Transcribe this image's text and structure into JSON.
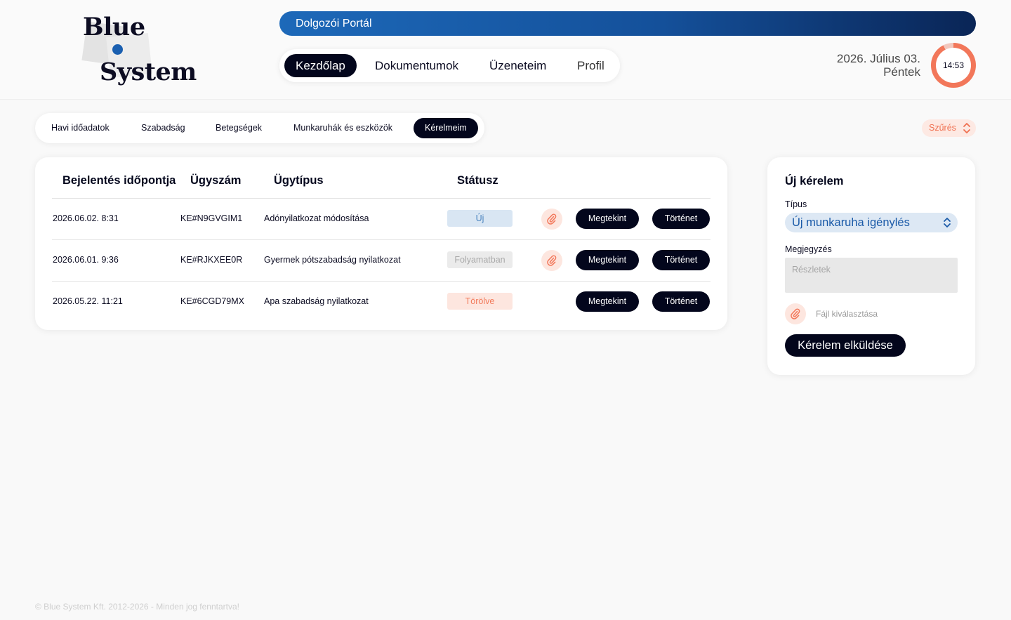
{
  "logo": {
    "line1": "Blue",
    "line2": "System"
  },
  "portal": {
    "title": "Dolgozói Portál"
  },
  "main_nav": {
    "items": [
      {
        "label": "Kezdőlap",
        "active": true
      },
      {
        "label": "Dokumentumok",
        "active": false
      },
      {
        "label": "Üzeneteim",
        "active": false
      },
      {
        "label": "Profil",
        "active": false
      }
    ]
  },
  "datetime": {
    "date": "2026. Július 03.",
    "weekday": "Péntek",
    "time": "14:53"
  },
  "sub_tabs": {
    "items": [
      {
        "label": "Havi időadatok",
        "active": false
      },
      {
        "label": "Szabadság",
        "active": false
      },
      {
        "label": "Betegségek",
        "active": false
      },
      {
        "label": "Munkaruhák és eszközök",
        "active": false
      },
      {
        "label": "Kérelmeim",
        "active": true
      }
    ]
  },
  "filter": {
    "label": "Szűrés"
  },
  "table": {
    "headers": [
      "Bejelentés időpontja",
      "Ügyszám",
      "Ügytípus",
      "Státusz"
    ],
    "rows": [
      {
        "date": "2026.06.02. 8:31",
        "case_no": "KE#N9GVGIM1",
        "type": "Adónyilatkozat módosítása",
        "status": "Új",
        "status_kind": "new",
        "has_attachment": true,
        "view": "Megtekint",
        "history": "Történet"
      },
      {
        "date": "2026.06.01. 9:36",
        "case_no": "KE#RJKXEE0R",
        "type": "Gyermek pótszabadság nyilatkozat",
        "status": "Folyamatban",
        "status_kind": "in-progress",
        "has_attachment": true,
        "view": "Megtekint",
        "history": "Történet"
      },
      {
        "date": "2026.05.22. 11:21",
        "case_no": "KE#6CGD79MX",
        "type": "Apa szabadság nyilatkozat",
        "status": "Törölve",
        "status_kind": "deleted",
        "has_attachment": false,
        "view": "Megtekint",
        "history": "Történet"
      }
    ]
  },
  "new_request": {
    "title": "Új kérelem",
    "type_label": "Típus",
    "type_value": "Új munkaruha igénylés",
    "note_label": "Megjegyzés",
    "note_placeholder": "Részletek",
    "file_label": "Fájl kiválasztása",
    "submit_label": "Kérelem elküldése"
  },
  "colors": {
    "accent_dark": "#03061c",
    "brand_blue": "#1a5fb0",
    "coral": "#f2775a",
    "status_new_bg": "#d9e6f3",
    "status_progress_bg": "#ebebeb",
    "status_deleted_bg": "#fde6df"
  },
  "icons": {
    "attachment": "paperclip-icon",
    "sort": "chevron-up-down-icon"
  },
  "footer": {
    "text": "© Blue System Kft. 2012-2026 - Minden jog fenntartva!"
  }
}
